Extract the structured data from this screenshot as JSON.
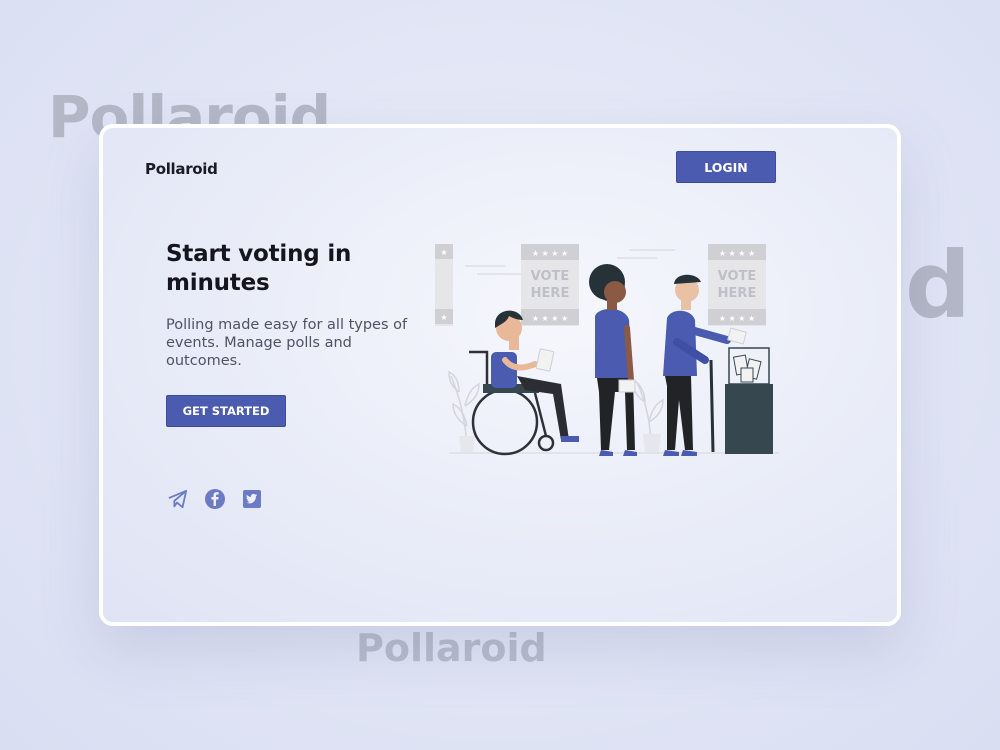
{
  "background_words": {
    "top_left": "Pollaroid",
    "right": "d",
    "bottom": "Pollaroid"
  },
  "header": {
    "brand": "Pollaroid",
    "login_label": "LOGIN"
  },
  "hero": {
    "title": "Start voting in minutes",
    "subtitle": "Polling made easy for all types of events. Manage polls and outcomes.",
    "cta_label": "GET STARTED"
  },
  "illustration": {
    "sign_text_line1": "VOTE",
    "sign_text_line2": "HERE"
  },
  "socials": [
    {
      "name": "telegram-icon"
    },
    {
      "name": "facebook-icon"
    },
    {
      "name": "twitter-icon"
    }
  ],
  "colors": {
    "accent": "#4a5bb0",
    "social_icon": "#6b7bc4",
    "title_text": "#15151f",
    "body_text": "#4e5263"
  }
}
